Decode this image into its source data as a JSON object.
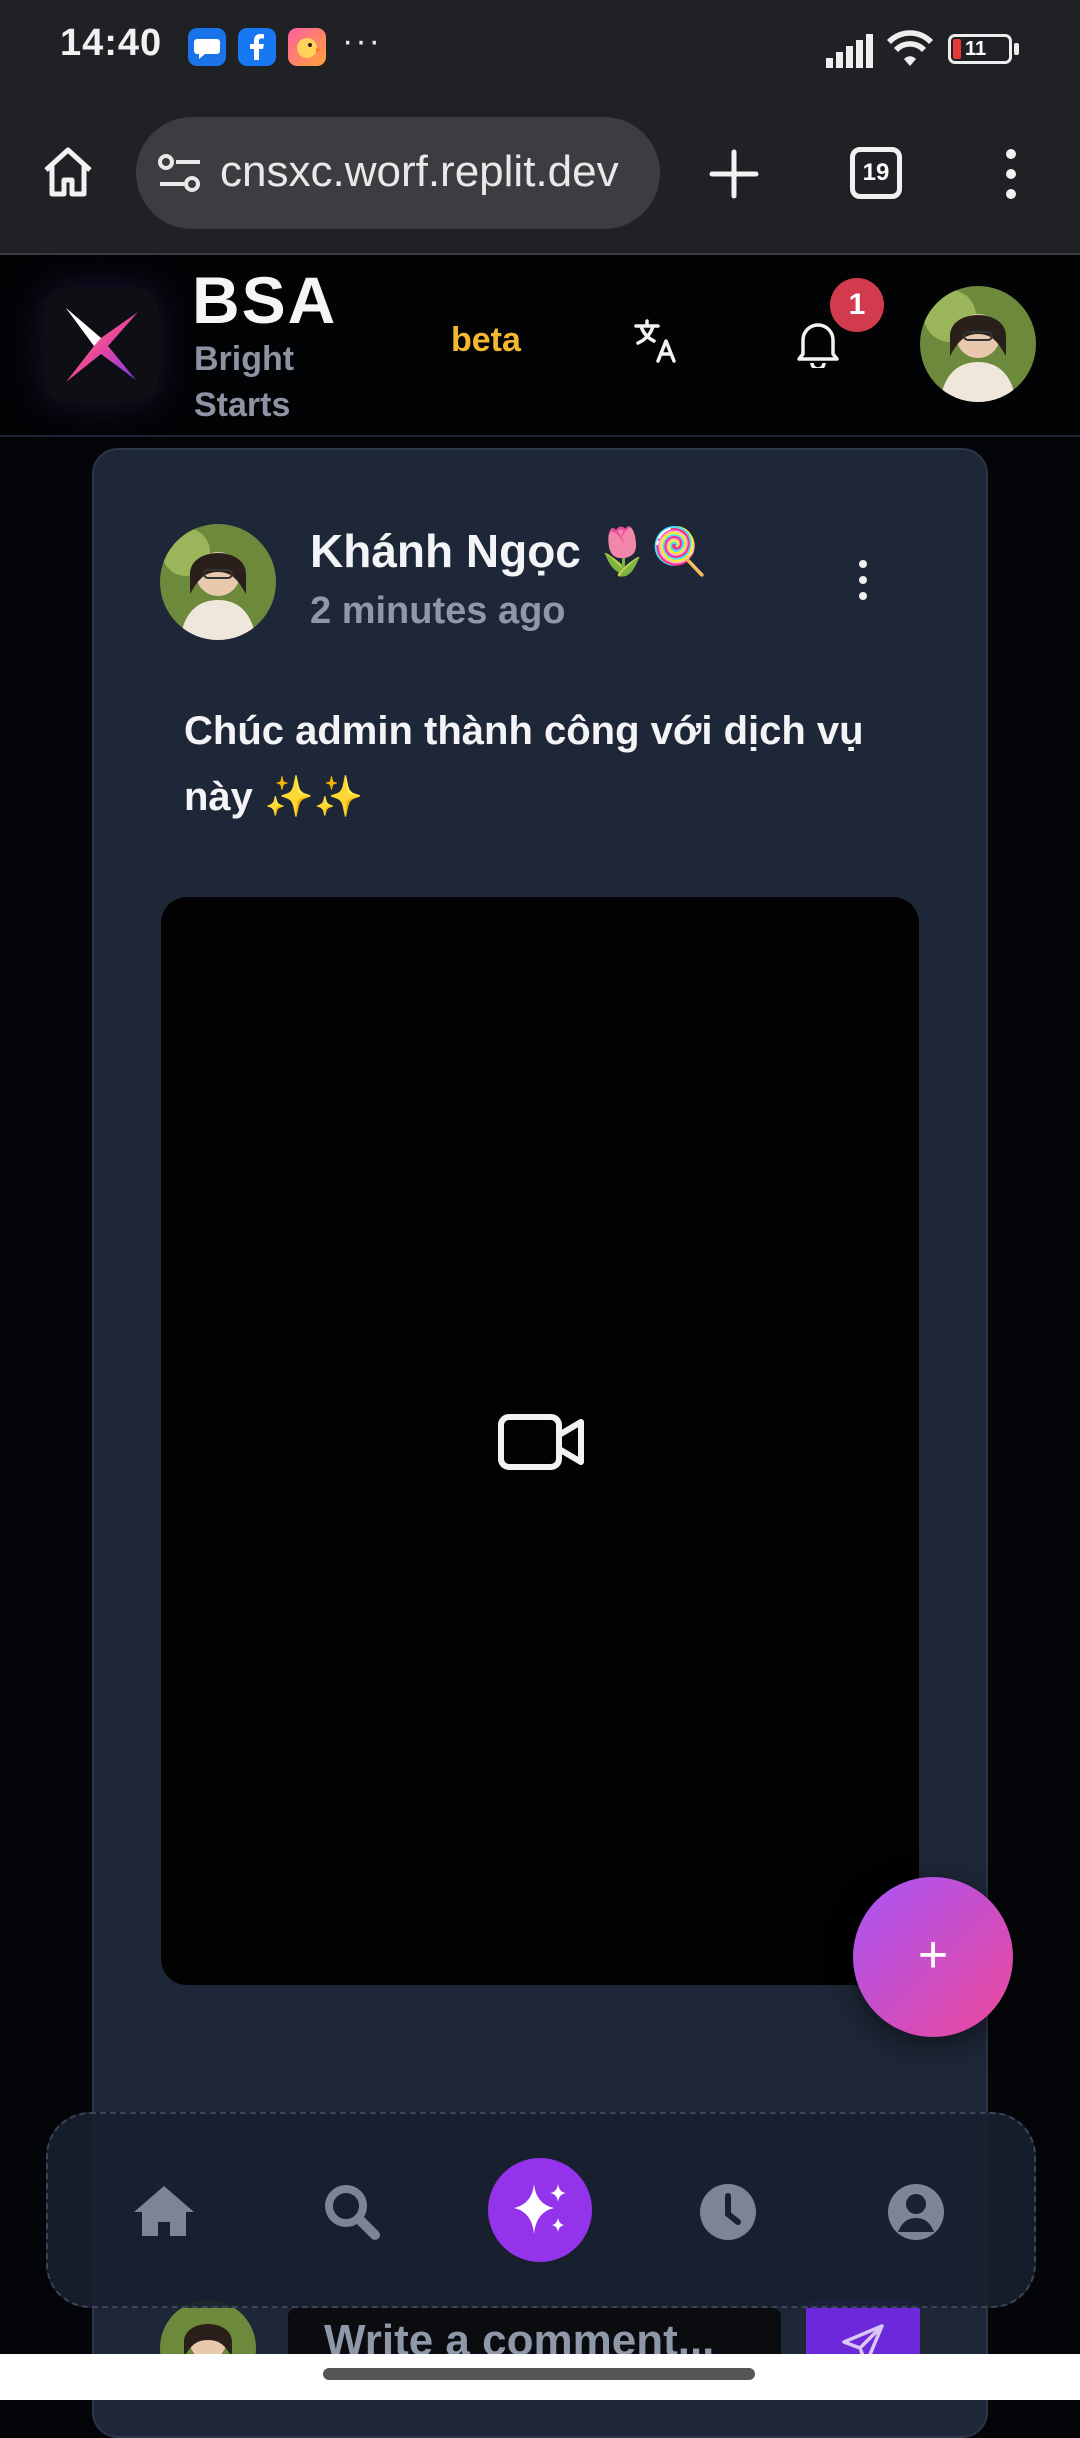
{
  "status_bar": {
    "time": "14:40",
    "overflow": "···",
    "battery": "11",
    "icons": [
      "messages-app-icon",
      "facebook-app-icon",
      "bird-app-icon",
      "signal-icon",
      "wifi-icon",
      "battery-icon"
    ]
  },
  "browser": {
    "url": "cnsxc.worf.replit.dev",
    "tab_count": "19",
    "icons": [
      "home-icon",
      "site-settings-icon",
      "new-tab-icon",
      "tabs-icon",
      "menu-icon"
    ]
  },
  "app_header": {
    "title": "BSA",
    "subtitle": "Bright Starts",
    "beta": "beta",
    "notification_count": "1"
  },
  "post": {
    "author": "Khánh Ngọc 🌷🍭",
    "time": "2 minutes ago",
    "text": "Chúc admin thành công với dịch vụ này ✨✨"
  },
  "fab": {
    "label": "+"
  },
  "bottom_nav": {
    "items": [
      "home",
      "search",
      "sparkle",
      "history",
      "profile"
    ],
    "active": "sparkle"
  },
  "comment": {
    "placeholder": "Write a comment..."
  },
  "colors": {
    "accent": "#9333ea",
    "beta": "#f5b731",
    "badge": "#d23b4e",
    "card": "#1e2738"
  }
}
